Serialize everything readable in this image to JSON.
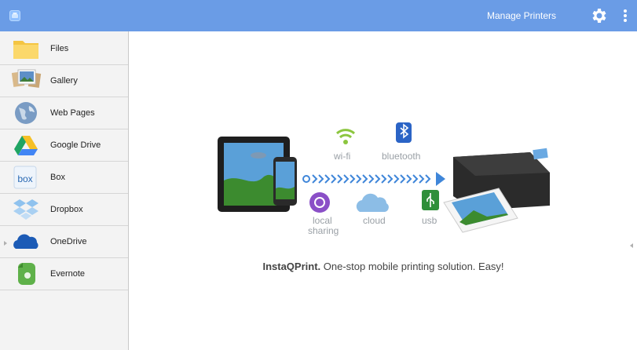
{
  "header": {
    "manage_label": "Manage Printers",
    "accent": "#6a9ce6"
  },
  "sidebar": {
    "items": [
      {
        "label": "Files",
        "icon": "folder-icon"
      },
      {
        "label": "Gallery",
        "icon": "gallery-icon"
      },
      {
        "label": "Web Pages",
        "icon": "globe-icon"
      },
      {
        "label": "Google Drive",
        "icon": "google-drive-icon"
      },
      {
        "label": "Box",
        "icon": "box-icon"
      },
      {
        "label": "Dropbox",
        "icon": "dropbox-icon"
      },
      {
        "label": "OneDrive",
        "icon": "onedrive-icon"
      },
      {
        "label": "Evernote",
        "icon": "evernote-icon"
      }
    ]
  },
  "hero": {
    "wifi_label": "wi-fi",
    "bluetooth_label": "bluetooth",
    "local_label_1": "local",
    "local_label_2": "sharing",
    "cloud_label": "cloud",
    "usb_label": "usb",
    "box_icon_text": "box"
  },
  "tagline": {
    "brand": "InstaQPrint.",
    "text": " One-stop mobile printing solution. Easy!"
  }
}
